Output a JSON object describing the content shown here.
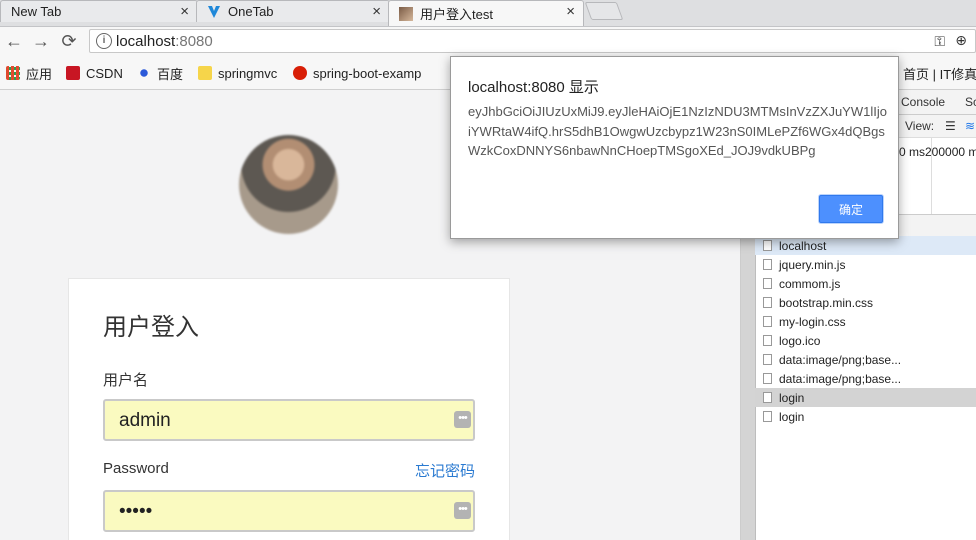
{
  "tabs": [
    {
      "label": "New Tab",
      "close": "×"
    },
    {
      "label": "OneTab",
      "close": "×"
    },
    {
      "label": "用户登入test",
      "close": "×"
    }
  ],
  "toolbar": {
    "back": "←",
    "forward": "→",
    "reload": "⟳",
    "info_icon": "i",
    "url_host": "localhost",
    "url_port": ":8080",
    "key_icon": "⚿",
    "zoom_icon": "⊕"
  },
  "bookmarks": [
    {
      "label": "应用",
      "color": "#e04a2f"
    },
    {
      "label": "CSDN",
      "color": "#c81623"
    },
    {
      "label": "百度",
      "color": "#2b59d9"
    },
    {
      "label": "springmvc",
      "color": "#f6d54a"
    },
    {
      "label": "spring-boot-examp",
      "color": "#d81e06"
    },
    {
      "label": "首页 | IT修真",
      "color": "#cccccc"
    }
  ],
  "page": {
    "title": "用户登入",
    "username_label": "用户名",
    "username_value": "admin",
    "password_label": "Password",
    "forgot_link": "忘记密码",
    "password_value": "•••••",
    "autofill_icon": "•••"
  },
  "devtools": {
    "tabs": [
      "Console",
      "Sc"
    ],
    "view_label": "View:",
    "timeline_text": "0 ms200000 m",
    "files": [
      "localhost",
      "jquery.min.js",
      "commom.js",
      "bootstrap.min.css",
      "my-login.css",
      "logo.ico",
      "data:image/png;base...",
      "data:image/png;base...",
      "login",
      "login"
    ]
  },
  "dialog": {
    "title": "localhost:8080 显示",
    "message": "eyJhbGciOiJIUzUxMiJ9.eyJleHAiOjE1NzIzNDU3MTMsInVzZXJuYW1lIjoiYWRtaW4ifQ.hrS5dhB1OwgwUzcbypz1W23nS0IMLePZf6WGx4dQBgsWzkCoxDNNYS6nbawNnCHoepTMSgoXEd_JOJ9vdkUBPg",
    "ok_label": "确定"
  },
  "colors": {
    "accent": "#4d90fe",
    "link": "#2a7ad1",
    "autofill": "#fafac0"
  }
}
